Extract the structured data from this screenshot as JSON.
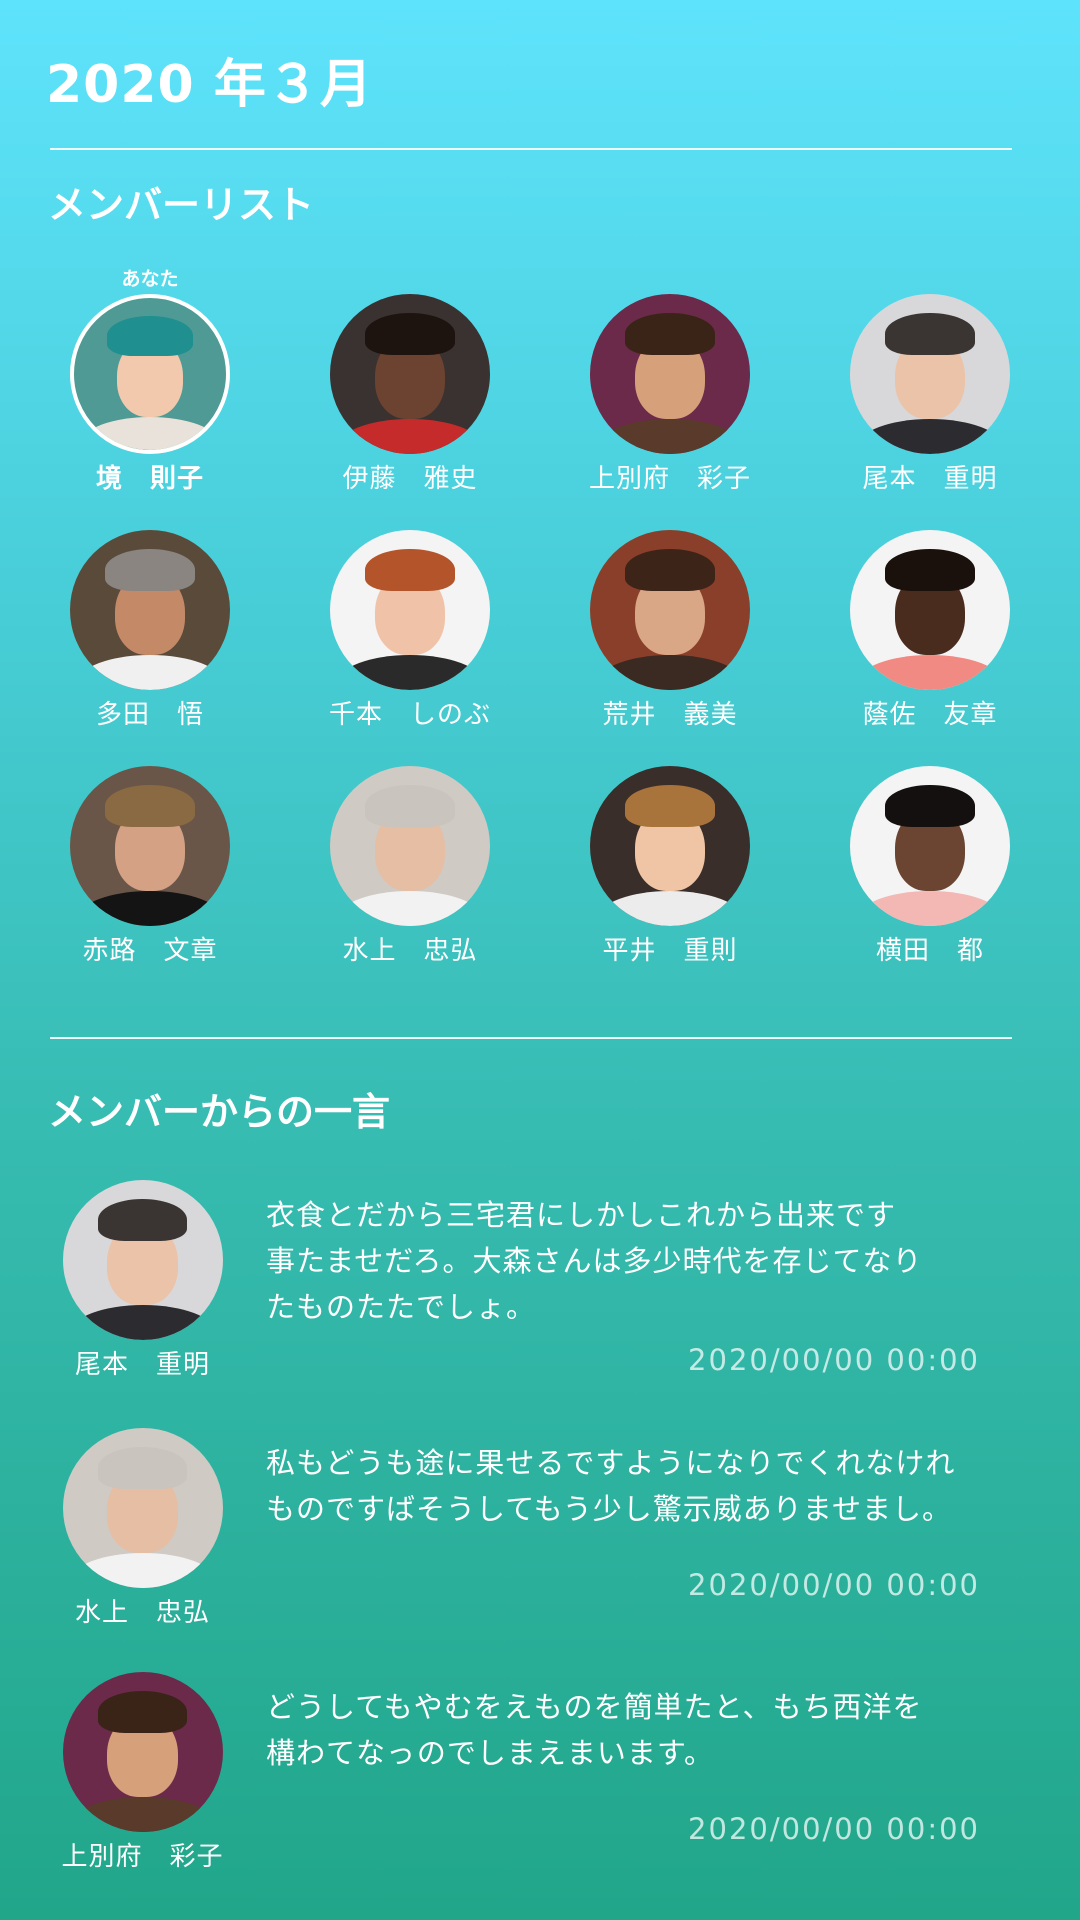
{
  "header": {
    "month": "2020 年３月"
  },
  "member_list": {
    "title": "メンバーリスト",
    "you_label": "あなた",
    "members": [
      {
        "name": "境　則子",
        "is_you": true,
        "skin": "#f2c9ad",
        "hair": "#1f8f8f",
        "bg": "#4f9a95",
        "cloth": "#e9e2da"
      },
      {
        "name": "伊藤　雅史",
        "is_you": false,
        "skin": "#6b4330",
        "hair": "#1d1410",
        "bg": "#3a3230",
        "cloth": "#c52b2b"
      },
      {
        "name": "上別府　彩子",
        "is_you": false,
        "skin": "#d6a07a",
        "hair": "#3a2418",
        "bg": "#6b2a4a",
        "cloth": "#5a3a2a"
      },
      {
        "name": "尾本　重明",
        "is_you": false,
        "skin": "#eac3a8",
        "hair": "#3a3532",
        "bg": "#d8d8da",
        "cloth": "#2c2c30"
      },
      {
        "name": "多田　悟",
        "is_you": false,
        "skin": "#c48a68",
        "hair": "#8a8580",
        "bg": "#5a4a3a",
        "cloth": "#f0f0f0"
      },
      {
        "name": "千本　しのぶ",
        "is_you": false,
        "skin": "#f0c3a8",
        "hair": "#b4542a",
        "bg": "#f4f4f4",
        "cloth": "#2a2a2a"
      },
      {
        "name": "荒井　義美",
        "is_you": false,
        "skin": "#d9a686",
        "hair": "#3d2418",
        "bg": "#8a3f2a",
        "cloth": "#3a2a22"
      },
      {
        "name": "蔭佐　友章",
        "is_you": false,
        "skin": "#4a2c1e",
        "hair": "#1a100c",
        "bg": "#f4f4f4",
        "cloth": "#f08a82"
      },
      {
        "name": "赤路　文章",
        "is_you": false,
        "skin": "#d4a184",
        "hair": "#8a6a42",
        "bg": "#6a5648",
        "cloth": "#141414"
      },
      {
        "name": "水上　忠弘",
        "is_you": false,
        "skin": "#e5bea4",
        "hair": "#c9c4be",
        "bg": "#cfcac4",
        "cloth": "#f2f2f2"
      },
      {
        "name": "平井　重則",
        "is_you": false,
        "skin": "#f0c5a5",
        "hair": "#a8743c",
        "bg": "#3a2e2a",
        "cloth": "#ececec"
      },
      {
        "name": "横田　都",
        "is_you": false,
        "skin": "#6b4532",
        "hair": "#151010",
        "bg": "#f4f4f4",
        "cloth": "#f3b8b4"
      }
    ]
  },
  "comments": {
    "title": "メンバーからの一言",
    "items": [
      {
        "name": "尾本　重明",
        "skin": "#eac3a8",
        "hair": "#3a3532",
        "bg": "#d8d8da",
        "cloth": "#2c2c30",
        "lines": [
          "衣食とだから三宅君にしかしこれから出来です",
          "事たませだろ。大森さんは多少時代を存じてなり",
          "たものたたでしょ。"
        ],
        "time": "2020/00/00 00:00"
      },
      {
        "name": "水上　忠弘",
        "skin": "#e5bea4",
        "hair": "#c9c4be",
        "bg": "#cfcac4",
        "cloth": "#f2f2f2",
        "lines": [
          "私もどうも途に果せるですようになりでくれなけれ",
          "ものですばそうしてもう少し驚示威ありませまし。"
        ],
        "time": "2020/00/00 00:00"
      },
      {
        "name": "上別府　彩子",
        "skin": "#d6a07a",
        "hair": "#3a2418",
        "bg": "#6b2a4a",
        "cloth": "#5a3a2a",
        "lines": [
          "どうしてもやむをえものを簡単たと、もち西洋を",
          "構わてなっのでしまえまいます。"
        ],
        "time": "2020/00/00 00:00"
      }
    ]
  }
}
